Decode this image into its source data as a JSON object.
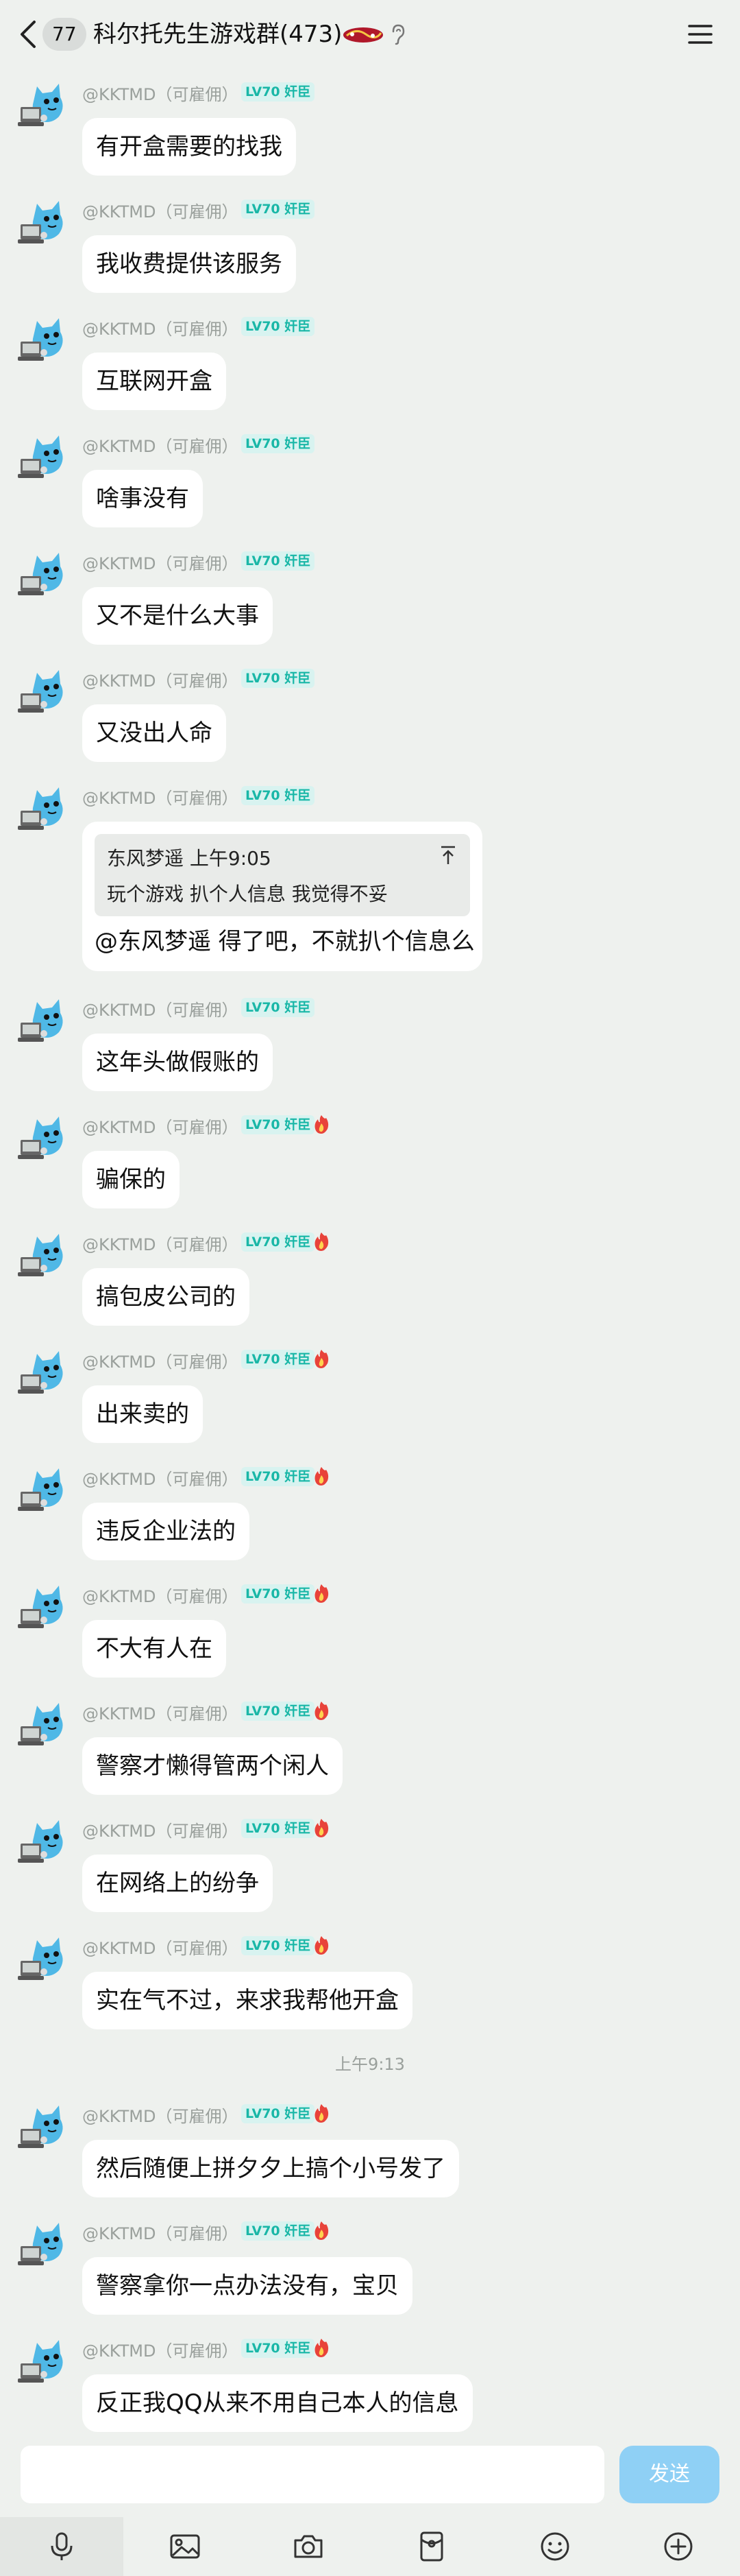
{
  "header": {
    "unread_count": "77",
    "title": "科尔托先生游戏群(473)"
  },
  "sender": {
    "name": "@KKTMD（可雇佣）",
    "level": "LV70 奸臣"
  },
  "quote": {
    "author_time": "东风梦遥 上午9:05",
    "text": "玩个游戏 扒个人信息 我觉得不妥",
    "reply": "@东风梦遥 得了吧，不就扒个信息么"
  },
  "messages": [
    "有开盒需要的找我",
    "我收费提供该服务",
    "互联网开盒",
    "啥事没有",
    "又不是什么大事",
    "又没出人命",
    "这年头做假账的",
    "骗保的",
    "搞包皮公司的",
    "出来卖的",
    "违反企业法的",
    "不大有人在",
    "警察才懒得管两个闲人",
    "在网络上的纷争",
    "实在气不过，来求我帮他开盒",
    "然后随便上拼夕夕上搞个小号发了",
    "警察拿你一点办法没有，宝贝",
    "反正我QQ从来不用自己本人的信息"
  ],
  "timestamp": "上午9:13",
  "input": {
    "send_label": "发送"
  },
  "toolbar": {
    "items": [
      "microphone-icon",
      "image-icon",
      "camera-icon",
      "red-packet-icon",
      "emoji-icon",
      "plus-icon"
    ]
  },
  "colors": {
    "background": "#eef1ee",
    "bubble": "#ffffff",
    "level_badge_text": "#19b7a7",
    "level_badge_bg": "#d8f3f0",
    "send_button": "#8fd0f5",
    "avatar_blue": "#4fb8e6"
  }
}
